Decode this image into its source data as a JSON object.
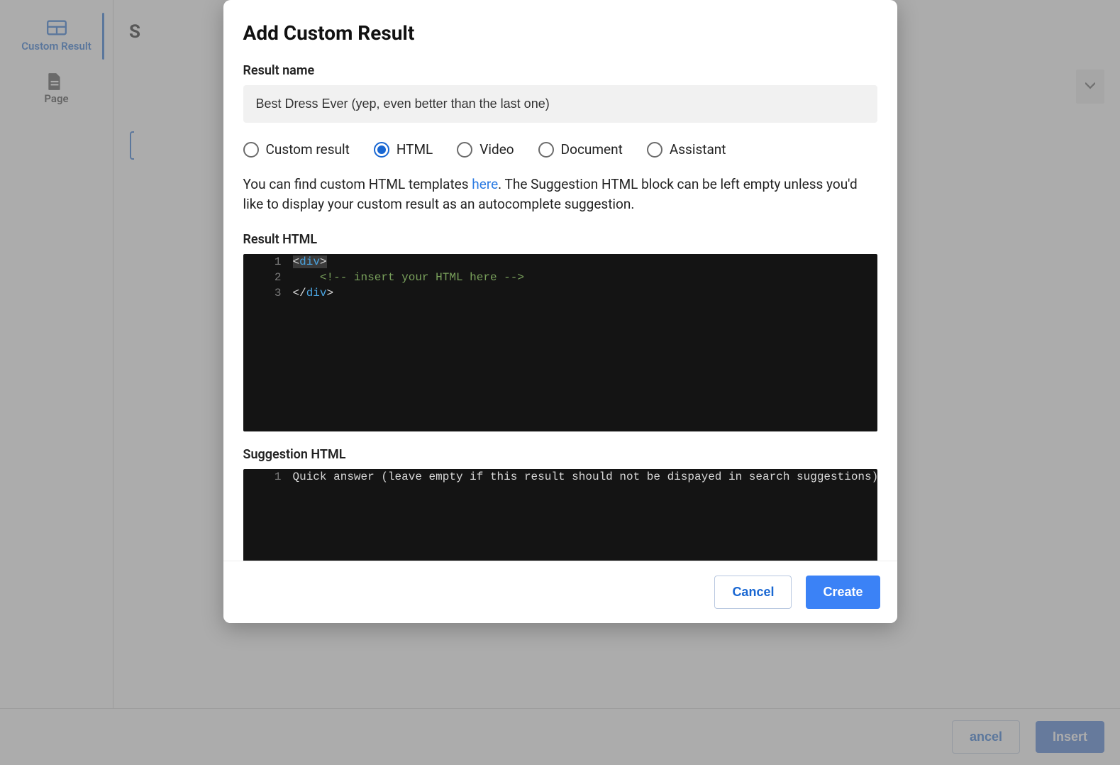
{
  "sidebar": {
    "items": [
      {
        "label": "Custom Result",
        "icon": "custom-result-icon",
        "active": true
      },
      {
        "label": "Page",
        "icon": "page-icon",
        "active": false
      }
    ]
  },
  "background": {
    "title_stub": "S",
    "buttons": {
      "cancel": "ancel",
      "insert": "Insert"
    }
  },
  "modal": {
    "title": "Add Custom Result",
    "result_name_label": "Result name",
    "result_name_value": "Best Dress Ever (yep, even better than the last one)",
    "type_options": [
      {
        "key": "custom",
        "label": "Custom result",
        "selected": false
      },
      {
        "key": "html",
        "label": "HTML",
        "selected": true
      },
      {
        "key": "video",
        "label": "Video",
        "selected": false
      },
      {
        "key": "document",
        "label": "Document",
        "selected": false
      },
      {
        "key": "assistant",
        "label": "Assistant",
        "selected": false
      }
    ],
    "help_text_pre": "You can find custom HTML templates ",
    "help_link": "here",
    "help_text_post": ". The Suggestion HTML block can be left empty unless you'd like to display your custom result as an autocomplete suggestion.",
    "result_html_label": "Result HTML",
    "result_html_lines": {
      "l1_open_angle": "<",
      "l1_tag": "div",
      "l1_close_angle": ">",
      "l2_comment": "<!-- insert your HTML here -->",
      "l3_open": "</",
      "l3_tag": "div",
      "l3_close": ">"
    },
    "line_numbers": {
      "n1": "1",
      "n2": "2",
      "n3": "3"
    },
    "suggestion_html_label": "Suggestion HTML",
    "suggestion_placeholder": "Quick answer (leave empty if this result should not be dispayed in search suggestions)",
    "suggestion_line_number": "1",
    "footer": {
      "cancel": "Cancel",
      "create": "Create"
    }
  }
}
